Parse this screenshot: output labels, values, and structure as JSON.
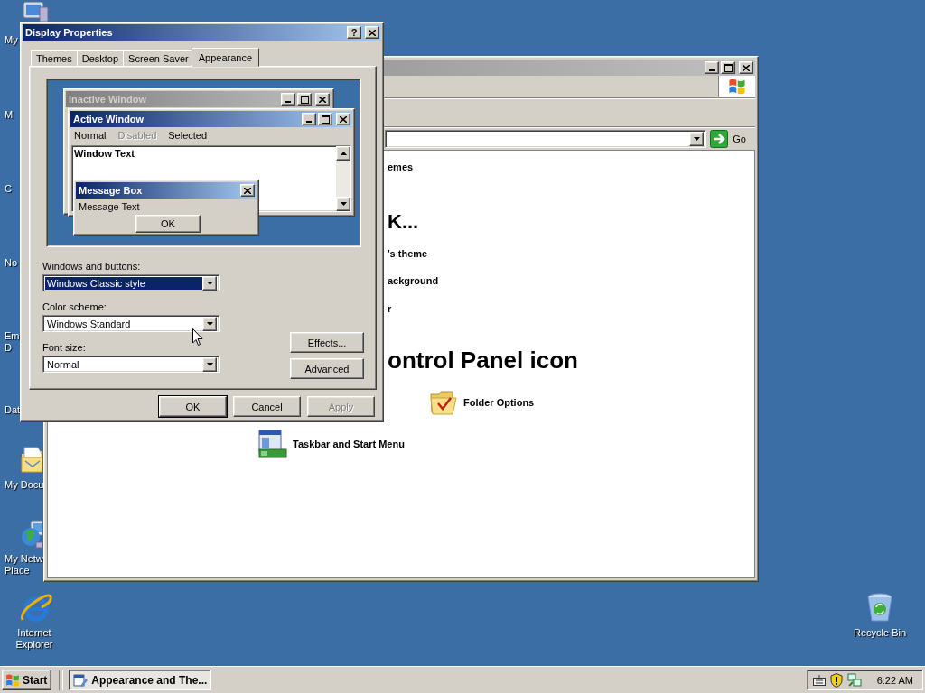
{
  "desktop_icons": [
    {
      "lines": [
        "My"
      ]
    },
    {
      "lines": [
        "M"
      ]
    },
    {
      "lines": [
        "C"
      ]
    },
    {
      "lines": [
        "No"
      ]
    },
    {
      "lines": [
        "Em",
        "D"
      ]
    },
    {
      "lines": [
        "Dat"
      ]
    },
    {
      "lines": [
        "My Docu"
      ]
    },
    {
      "lines": [
        "My Netw",
        "Place"
      ]
    },
    {
      "lines": [
        "Internet",
        "Explorer"
      ]
    },
    {
      "lines": [
        "Recycle Bin"
      ]
    }
  ],
  "background_window": {
    "go_button": "Go",
    "content": [
      {
        "kind": "task",
        "text": "emes"
      },
      {
        "kind": "heading",
        "text": "K..."
      },
      {
        "kind": "task",
        "text": "'s theme"
      },
      {
        "kind": "task",
        "text": "ackground"
      },
      {
        "kind": "task",
        "text": "r"
      },
      {
        "kind": "title",
        "text": "ontrol Panel icon"
      },
      {
        "kind": "link",
        "text": "Folder Options"
      },
      {
        "kind": "link",
        "text": "Taskbar and Start Menu"
      }
    ]
  },
  "dialog": {
    "title": "Display Properties",
    "help_button": "?",
    "tabs": [
      {
        "label": "Themes",
        "selected": false
      },
      {
        "label": "Desktop",
        "selected": false
      },
      {
        "label": "Screen Saver",
        "selected": false
      },
      {
        "label": "Appearance",
        "selected": true
      }
    ],
    "preview": {
      "inactive_title": "Inactive Window",
      "active_title": "Active Window",
      "menu": [
        {
          "label": "Normal",
          "disabled": false
        },
        {
          "label": "Disabled",
          "disabled": true
        },
        {
          "label": "Selected",
          "disabled": false
        }
      ],
      "window_text": "Window Text",
      "message_title": "Message Box",
      "message_text": "Message Text",
      "message_button": "OK"
    },
    "fields": [
      {
        "label": "Windows and buttons:",
        "value": "Windows Classic style",
        "focused": true
      },
      {
        "label": "Color scheme:",
        "value": "Windows Standard",
        "focused": false
      },
      {
        "label": "Font size:",
        "value": "Normal",
        "focused": false
      }
    ],
    "side_buttons": [
      "Effects...",
      "Advanced"
    ],
    "buttons": [
      {
        "label": "OK",
        "default": true,
        "disabled": false
      },
      {
        "label": "Cancel",
        "default": false,
        "disabled": false
      },
      {
        "label": "Apply",
        "default": false,
        "disabled": true
      }
    ]
  },
  "taskbar": {
    "start": "Start",
    "tasks": [
      {
        "label": "Appearance and The...",
        "selected": true
      }
    ],
    "clock": "6:22 AM"
  }
}
